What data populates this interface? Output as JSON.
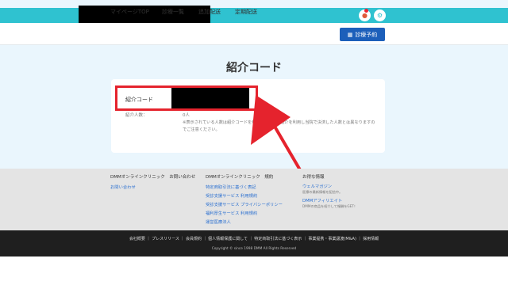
{
  "header": {
    "icons": [
      "bell-icon",
      "gear-icon"
    ]
  },
  "nav": {
    "items": [
      "マイページTOP",
      "診療一覧",
      "追加配送",
      "定期配送"
    ],
    "cta_label": "診療予約",
    "cta_icon": "calendar-icon"
  },
  "main": {
    "title": "紹介コード",
    "code_label": "紹介コード",
    "count_label": "紹介人数：",
    "count_value": "0人",
    "note": "※表示されている人数は紹介コードを利用して、友達紹介を利用し当院で決済した人数とは異なりますのでご注意ください。"
  },
  "footer": {
    "col1_head": "DMMオンラインクリニック　お問い合わせ",
    "col1_links": [
      "お問い合わせ"
    ],
    "col2_head": "DMMオンラインクリニック　規約",
    "col2_links": [
      "特定商取引法に基づく表記",
      "受診支援サービス 利用規約",
      "受診支援サービス プライバシーポリシー",
      "福利厚生サービス 利用規約",
      "運営医療法人"
    ],
    "col3_head": "お得な情報",
    "col3_link1": "ウェルマガジン",
    "col3_sub1": "医療の最新情報を配信中。",
    "col3_link2": "DMMアフィリエイト",
    "col3_sub2": "DMMの商品を紹介して報酬をGET！",
    "bottom_links": "会社概要 ｜ プレスリリース ｜ 会員規約 ｜ 個人情報保護に関して ｜ 特定商取引法に基づく表示 ｜ 事業提携・事業譲渡(M&A) ｜ 採用情報",
    "copyright": "Copyright © since 1998 DMM All Rights Reserved"
  },
  "colors": {
    "topbar": "#2fc2d0",
    "accent_blue": "#1c5fba",
    "highlight_red": "#e5232d"
  }
}
